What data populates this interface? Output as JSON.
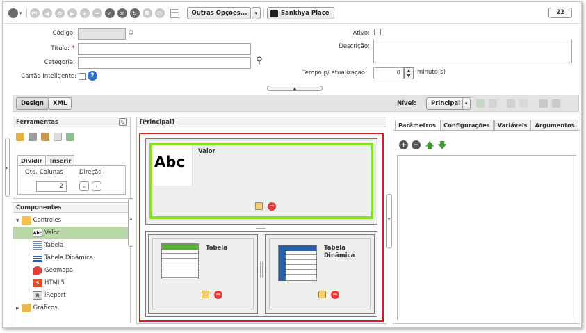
{
  "toolbar": {
    "more_options": "Outras Opções...",
    "place": "Sankhya Place",
    "count": "22"
  },
  "form": {
    "codigo_label": "Código:",
    "titulo_label": "Título:",
    "titulo_required": "*",
    "categoria_label": "Categoria:",
    "cartao_label": "Cartão Inteligente:",
    "ativo_label": "Ativo:",
    "descricao_label": "Descrição:",
    "tempo_label": "Tempo p/ atualização:",
    "tempo_value": "0",
    "tempo_unit": "minuto(s)"
  },
  "viewbar": {
    "design": "Design",
    "xml": "XML",
    "nivel_label": "Nível:",
    "nivel_value": "Principal"
  },
  "ferramentas": {
    "title": "Ferramentas",
    "tabs": [
      "Dividir",
      "Inserir"
    ],
    "qtd_label": "Qtd. Colunas",
    "direcao_label": "Direção",
    "qtd_value": "2"
  },
  "componentes": {
    "title": "Componentes",
    "items": [
      {
        "label": "Controles",
        "icon": "folder-open-icon",
        "level": 0,
        "arrow": "▼"
      },
      {
        "label": "Valor",
        "icon": "abc-icon",
        "level": 1,
        "selected": true
      },
      {
        "label": "Tabela",
        "icon": "table-icon",
        "level": 1
      },
      {
        "label": "Tabela Dinâmica",
        "icon": "pivot-table-icon",
        "level": 1
      },
      {
        "label": "Geomapa",
        "icon": "map-icon",
        "level": 1
      },
      {
        "label": "HTML5",
        "icon": "html5-icon",
        "level": 1
      },
      {
        "label": "iReport",
        "icon": "ireport-icon",
        "level": 1
      },
      {
        "label": "Gráficos",
        "icon": "folder-icon",
        "level": 0,
        "arrow": "▶"
      }
    ]
  },
  "canvas": {
    "title": "[Principal]",
    "valor_label": "Valor",
    "abc_text": "Abc",
    "tabela_label": "Tabela",
    "tabela_dinamica_label": "Tabela Dinâmica"
  },
  "right_panel": {
    "tabs": [
      "Parâmetros",
      "Configurações",
      "Variáveis",
      "Argumentos"
    ]
  },
  "colors": {
    "selection_red": "#d0202a",
    "selection_green": "#86e11f",
    "selected_row": "#b9d7a6"
  }
}
